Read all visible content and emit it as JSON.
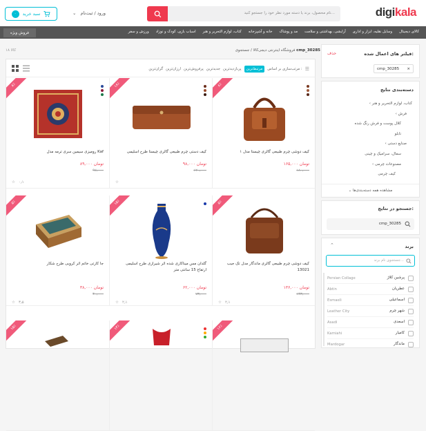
{
  "header": {
    "logo": "digikala",
    "search_placeholder": "نام محصول، برند یا دسته مورد نظر خود را جستجو کنید…",
    "login": "ورود / ثبت‌نام",
    "cart_label": "سبد خرید",
    "cart_count": "۰"
  },
  "nav": {
    "items": [
      "کالای دیجیتال",
      "وسایل نقلیه، ابزار و اداری",
      "آرایشی، بهداشتی و سلامت",
      "مد و پوشاک",
      "خانه و آشپزخانه",
      "کتاب، لوازم التحریر و هنر",
      "اسباب بازی، کودک و نوزاد",
      "ورزش و سفر"
    ],
    "sale": "فروش ویژه"
  },
  "breadcrumb": {
    "store": "فروشگاه اینترنتی دیجی‌کالا",
    "sep": " / ",
    "query_label": "جستجوی",
    "query": "cmp_30285"
  },
  "total": "۱۸ کالا",
  "filters": {
    "title": "فیلتر های اعمال شده:",
    "remove": "حذف",
    "chip": "cmp_30285"
  },
  "categories": {
    "title": "دسته‌بندی نتایج",
    "items": [
      "کتاب، لوازم التحریر و هنر",
      "فرش",
      "کلال پوست و فرش رنگ شده",
      "تابلو",
      "صنایع دستی",
      "سفال، سرامیک و چینی",
      "مصنوعات چرمی",
      "کیف چرمی"
    ],
    "more": "مشاهده همه دسته‌بندی‌ها"
  },
  "insearch": {
    "title": "جستجو در نتایج:",
    "value": "cmp_30285"
  },
  "brand": {
    "title": "برند",
    "placeholder": "جستجوی نام برند...",
    "rows": [
      {
        "en": "Persian Collage",
        "fa": "پرشین کلاژ"
      },
      {
        "en": "Abtin",
        "fa": "عطریان"
      },
      {
        "en": "Esmaeli",
        "fa": "اسماعیلی"
      },
      {
        "en": "Leather City",
        "fa": "شهر چرم"
      },
      {
        "en": "Asadi",
        "fa": "اسعدی"
      },
      {
        "en": "Kamiahi",
        "fa": "کامیار"
      },
      {
        "en": "Mardogar",
        "fa": "ماندگار"
      }
    ]
  },
  "sort": {
    "label": "مرتب‌سازی بر اساس :",
    "options": [
      "مرتبط‌ترین",
      "پربازدیدترین",
      "جدیدترین",
      "پرفروش‌ترین",
      "ارزان‌ترین",
      "گران‌ترین"
    ],
    "active": "مرتبط‌ترین"
  },
  "products": [
    {
      "name": "کیف دوشی چرم طبیعی گالری چیستا مدل ۱",
      "price": "۱۶۵,۰۰۰ تومان",
      "old": "۱۸۰,۰۰۰",
      "discount": "۸٪",
      "rating": "",
      "colors": [
        "#7a3a22",
        "#a05a3a",
        "#5a2a1a"
      ]
    },
    {
      "name": "کیف دستی چرم طبیعی گالری چیستا طرح اسلیمی",
      "price": "۹۸,۰۰۰ تومان",
      "old": "۱۲۰,۰۰۰",
      "discount": "۱۸٪",
      "rating": "",
      "colors": [
        "#6b2e1c",
        "#9a4a2a",
        "#3a1a10"
      ]
    },
    {
      "name": "رومیزی سیمین سری ترمه مدل Kaf",
      "price": "۸۹,۰۰۰ تومان",
      "old": "۹۷,۰۰۰",
      "discount": "۸٪",
      "rating": "۰٫۱",
      "colors": [
        "#2a4a9a",
        "#8a1a3a",
        "#1a7a4a"
      ]
    },
    {
      "name": "کیف دوشی چرم طبیعی گالری ماندگار مدل تک جیب 13021",
      "price": "۱۳۶,۰۰۰ تومان",
      "old": "۱۴۳,۰۰۰",
      "discount": "۵٪",
      "rating": "۲٫۱",
      "colors": []
    },
    {
      "name": "گلدان مس میناکاری شده اثر شیرازی طرح اسلیمی ارتفاع 15 سانتی متر",
      "price": "۶۲,۰۰۰ تومان",
      "old": "۷۳,۰۰۰",
      "discount": "۱۵٪",
      "rating": "۲٫۱",
      "colors": [
        "#1a3aaa"
      ]
    },
    {
      "name": "جا کارتی خاتم اثر کروبی طرح شکار",
      "price": "۳۸,۰۰۰ تومان",
      "old": "۴۰,۰۰۰",
      "discount": "۵٪",
      "rating": "۳٫۵",
      "colors": []
    },
    {
      "name": "",
      "price": "",
      "old": "",
      "discount": "۱۶٪",
      "rating": "",
      "colors": []
    },
    {
      "name": "",
      "price": "",
      "old": "",
      "discount": "۱۴٪",
      "rating": "",
      "colors": [
        "#e33",
        "#fa0",
        "#3a3"
      ]
    },
    {
      "name": "",
      "price": "",
      "old": "",
      "discount": "۱۵٪",
      "rating": "",
      "colors": []
    }
  ]
}
